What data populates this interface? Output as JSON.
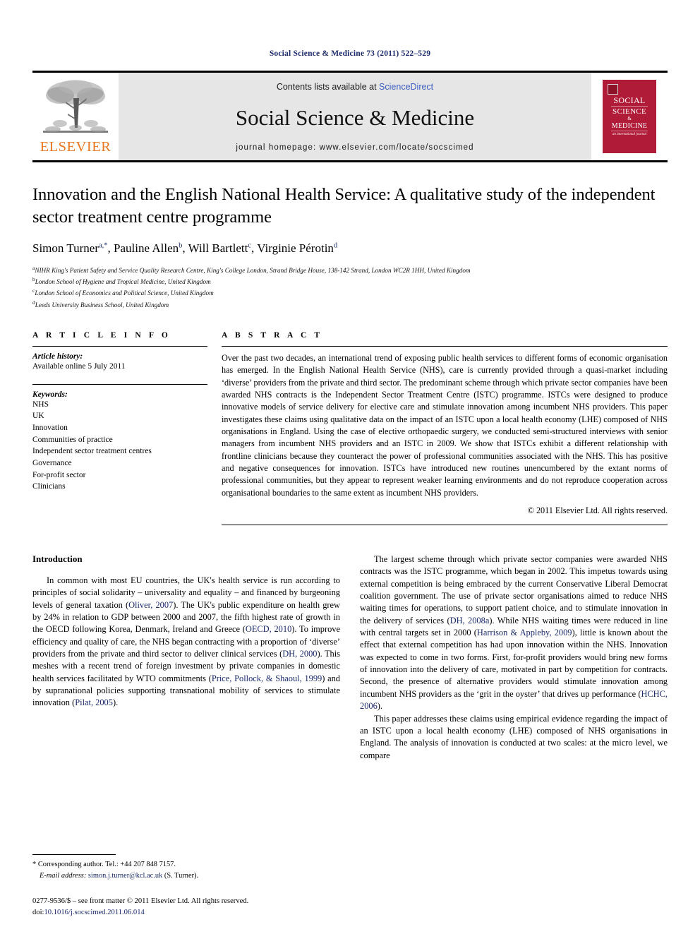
{
  "running_head": "Social Science & Medicine 73 (2011) 522–529",
  "masthead": {
    "publisher_wordmark": "ELSEVIER",
    "contents_prefix": "Contents lists available at ",
    "contents_link": "ScienceDirect",
    "journal_name": "Social Science & Medicine",
    "homepage_line": "journal homepage: www.elsevier.com/locate/socscimed",
    "cover": {
      "line1": "SOCIAL",
      "line2": "SCIENCE",
      "amp": "&",
      "line3": "MEDICINE",
      "subtitle": "an international journal",
      "color": "#b01c38"
    },
    "link_color": "#3b5ec2",
    "wordmark_color": "#e87722"
  },
  "article": {
    "title": "Innovation and the English National Health Service: A qualitative study of the independent sector treatment centre programme",
    "authors": [
      {
        "name": "Simon Turner",
        "marks": "a,*"
      },
      {
        "name": "Pauline Allen",
        "marks": "b"
      },
      {
        "name": "Will Bartlett",
        "marks": "c"
      },
      {
        "name": "Virginie Pérotin",
        "marks": "d"
      }
    ],
    "affiliations": [
      {
        "mark": "a",
        "text": "NIHR King's Patient Safety and Service Quality Research Centre, King's College London, Strand Bridge House, 138-142 Strand, London WC2R 1HH, United Kingdom"
      },
      {
        "mark": "b",
        "text": "London School of Hygiene and Tropical Medicine, United Kingdom"
      },
      {
        "mark": "c",
        "text": "London School of Economics and Political Science, United Kingdom"
      },
      {
        "mark": "d",
        "text": "Leeds University Business School, United Kingdom"
      }
    ]
  },
  "article_info": {
    "heading": "A R T I C L E   I N F O",
    "history_label": "Article history:",
    "history_value": "Available online 5 July 2011",
    "keywords_label": "Keywords:",
    "keywords": [
      "NHS",
      "UK",
      "Innovation",
      "Communities of practice",
      "Independent sector treatment centres",
      "Governance",
      "For-profit sector",
      "Clinicians"
    ]
  },
  "abstract": {
    "heading": "A B S T R A C T",
    "text": "Over the past two decades, an international trend of exposing public health services to different forms of economic organisation has emerged. In the English National Health Service (NHS), care is currently provided through a quasi-market including ‘diverse’ providers from the private and third sector. The predominant scheme through which private sector companies have been awarded NHS contracts is the Independent Sector Treatment Centre (ISTC) programme. ISTCs were designed to produce innovative models of service delivery for elective care and stimulate innovation among incumbent NHS providers. This paper investigates these claims using qualitative data on the impact of an ISTC upon a local health economy (LHE) composed of NHS organisations in England. Using the case of elective orthopaedic surgery, we conducted semi-structured interviews with senior managers from incumbent NHS providers and an ISTC in 2009. We show that ISTCs exhibit a different relationship with frontline clinicians because they counteract the power of professional communities associated with the NHS. This has positive and negative consequences for innovation. ISTCs have introduced new routines unencumbered by the extant norms of professional communities, but they appear to represent weaker learning environments and do not reproduce cooperation across organisational boundaries to the same extent as incumbent NHS providers.",
    "copyright": "© 2011 Elsevier Ltd. All rights reserved."
  },
  "body": {
    "section_heading": "Introduction",
    "left_paragraphs": [
      [
        {
          "t": "In common with most EU countries, the UK's health service is run according to principles of social solidarity – universality and equality – and financed by burgeoning levels of general taxation ("
        },
        {
          "t": "Oliver, 2007",
          "cite": true
        },
        {
          "t": "). The UK's public expenditure on health grew by 24% in relation to GDP between 2000 and 2007, the fifth highest rate of growth in the OECD following Korea, Denmark, Ireland and Greece ("
        },
        {
          "t": "OECD, 2010",
          "cite": true
        },
        {
          "t": "). To improve efficiency and quality of care, the NHS began contracting with a proportion of ‘diverse’ providers from the private and third sector to deliver clinical services ("
        },
        {
          "t": "DH, 2000",
          "cite": true
        },
        {
          "t": "). This meshes with a recent trend of foreign investment by private companies in domestic health services facilitated by WTO commitments ("
        },
        {
          "t": "Price, Pollock, & Shaoul, 1999",
          "cite": true
        },
        {
          "t": ") and by supranational policies supporting transnational mobility of services to stimulate innovation ("
        },
        {
          "t": "Pilat, 2005",
          "cite": true
        },
        {
          "t": ")."
        }
      ]
    ],
    "right_paragraphs": [
      [
        {
          "t": "The largest scheme through which private sector companies were awarded NHS contracts was the ISTC programme, which began in 2002. This impetus towards using external competition is being embraced by the current Conservative Liberal Democrat coalition government. The use of private sector organisations aimed to reduce NHS waiting times for operations, to support patient choice, and to stimulate innovation in the delivery of services ("
        },
        {
          "t": "DH, 2008a",
          "cite": true
        },
        {
          "t": "). While NHS waiting times were reduced in line with central targets set in 2000 ("
        },
        {
          "t": "Harrison & Appleby, 2009",
          "cite": true
        },
        {
          "t": "), little is known about the effect that external competition has had upon innovation within the NHS. Innovation was expected to come in two forms. First, for-profit providers would bring new forms of innovation into the delivery of care, motivated in part by competition for contracts. Second, the presence of alternative providers would stimulate innovation among incumbent NHS providers as the ‘grit in the oyster’ that drives up performance ("
        },
        {
          "t": "HCHC, 2006",
          "cite": true
        },
        {
          "t": ")."
        }
      ],
      [
        {
          "t": "This paper addresses these claims using empirical evidence regarding the impact of an ISTC upon a local health economy (LHE) composed of NHS organisations in England. The analysis of innovation is conducted at two scales: at the micro level, we compare"
        }
      ]
    ]
  },
  "footnotes": {
    "corresponding_marker": "*",
    "corresponding_text": "Corresponding author. Tel.: +44 207 848 7157.",
    "email_label": "E-mail address:",
    "email": "simon.j.turner@kcl.ac.uk",
    "email_suffix": "(S. Turner).",
    "issn_line": "0277-9536/$ – see front matter © 2011 Elsevier Ltd. All rights reserved.",
    "doi_label": "doi:",
    "doi_value": "10.1016/j.socscimed.2011.06.014"
  }
}
